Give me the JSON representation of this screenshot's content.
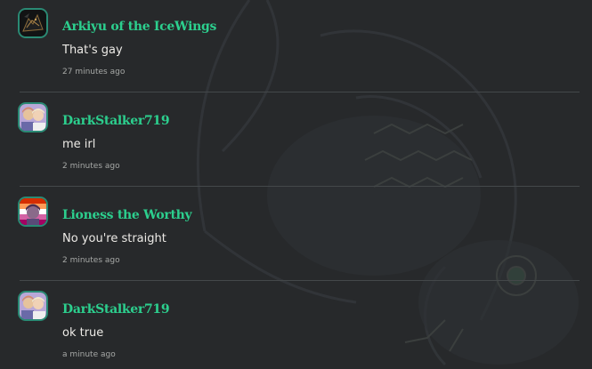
{
  "comments": [
    {
      "username": "Arkiyu of the IceWings",
      "message": "That's gay",
      "timestamp": "27 minutes ago",
      "avatar_icon": "black-dragon-avatar-icon"
    },
    {
      "username": "DarkStalker719",
      "message": "me irl",
      "timestamp": "2 minutes ago",
      "avatar_icon": "couple-avatar-icon"
    },
    {
      "username": "Lioness the Worthy",
      "message": "No you're straight",
      "timestamp": "2 minutes ago",
      "avatar_icon": "lesbian-flag-avatar-icon"
    },
    {
      "username": "DarkStalker719",
      "message": "ok true",
      "timestamp": "a minute ago",
      "avatar_icon": "couple-avatar-icon"
    }
  ],
  "colors": {
    "background": "#27292b",
    "username": "#2ccf8e",
    "message": "#eceae6",
    "timestamp": "#a6a8a6",
    "divider": "#44484a"
  }
}
